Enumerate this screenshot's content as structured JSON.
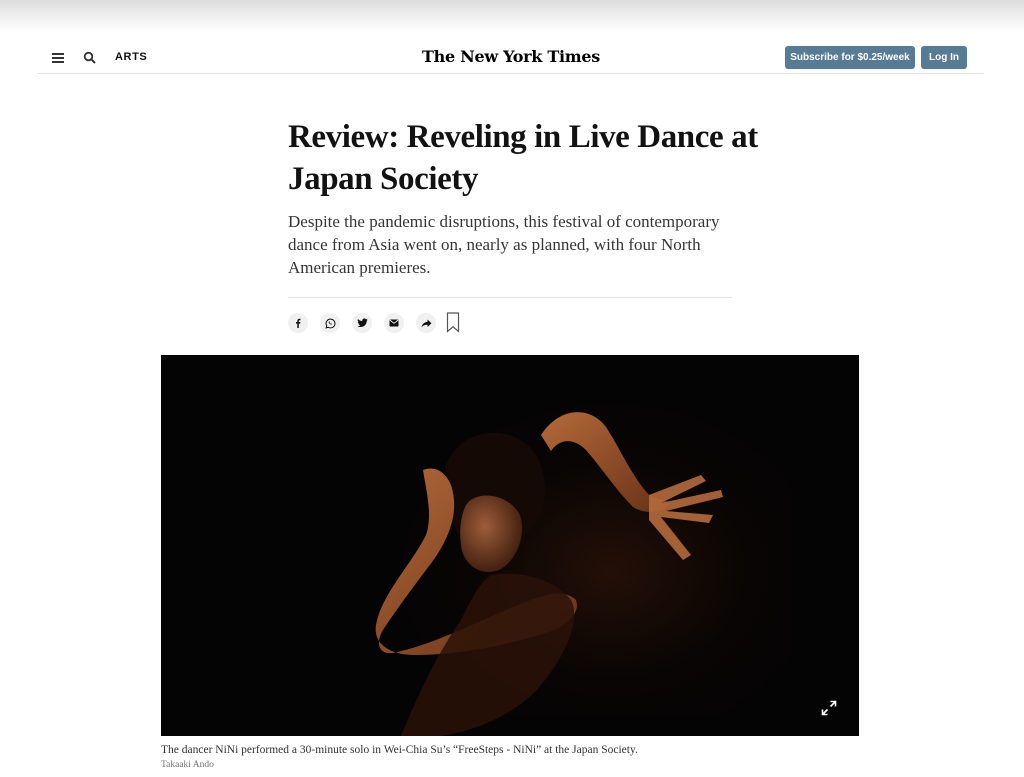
{
  "header": {
    "section": "ARTS",
    "logo": "The New York Times",
    "subscribe_label": "Subscribe for $0.25/week",
    "login_label": "Log In"
  },
  "article": {
    "headline": "Review: Reveling in Live Dance at Japan Society",
    "summary": "Despite the pandemic disruptions, this festival of contemporary dance from Asia went on, nearly as planned, with four North American premieres."
  },
  "share": {
    "items": [
      {
        "icon": "facebook-icon"
      },
      {
        "icon": "whatsapp-icon"
      },
      {
        "icon": "twitter-icon"
      },
      {
        "icon": "email-icon"
      },
      {
        "icon": "share-arrow-icon"
      }
    ],
    "save_icon": "bookmark-icon"
  },
  "photo": {
    "caption": "The dancer NiNi performed a 30-minute solo in Wei-Chia Su’s “FreeSteps - NiNi” at the Japan Society.",
    "credit": "Takaaki Ando"
  },
  "colors": {
    "button_bg": "#567b95",
    "photo_bg": "#050404",
    "skin": "#b5643a"
  }
}
